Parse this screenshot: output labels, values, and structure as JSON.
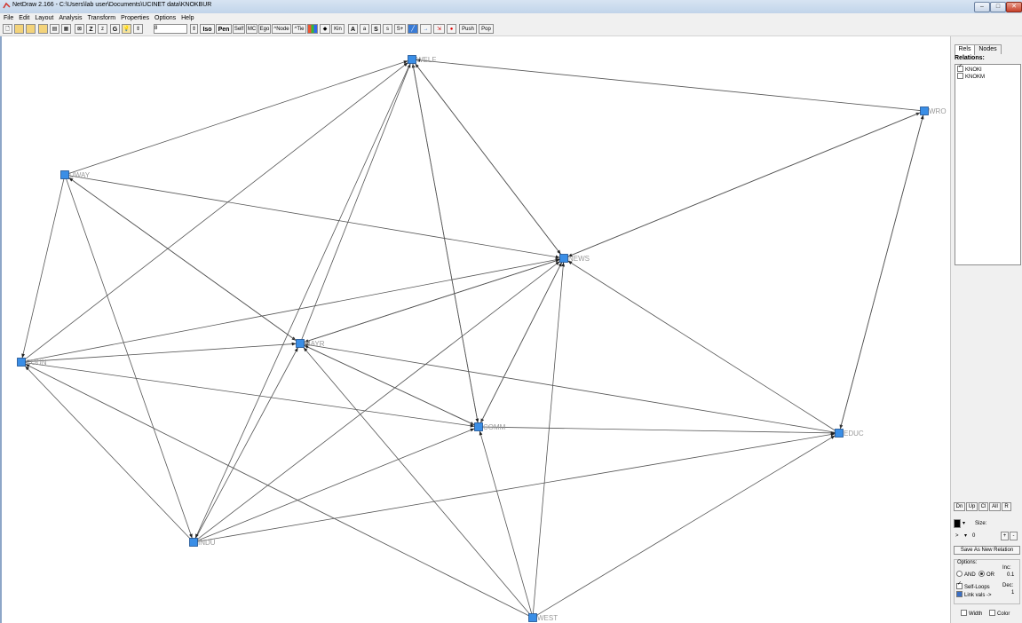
{
  "window": {
    "title": "NetDraw 2.166 - C:\\Users\\lab user\\Documents\\UCINET data\\KNOKBUR",
    "min_label": "–",
    "max_label": "□",
    "close_label": "✕"
  },
  "menu": [
    "File",
    "Edit",
    "Layout",
    "Analysis",
    "Transform",
    "Properties",
    "Options",
    "Help"
  ],
  "toolbar": {
    "z_label": "Z",
    "z_small_label": "z",
    "g_label": "G",
    "iso_label": "Iso",
    "pen_label": "Pen",
    "self_label": "Self",
    "mc_label": "MC",
    "ego_label": "Ego",
    "node_label": "^Node",
    "tie_label": "^Tie",
    "kin_label": "Kin",
    "a_label": "A",
    "a_small_label": "a",
    "s_label": "S",
    "s_small_label": "s",
    "s_plus_label": "S+",
    "push_label": "Push",
    "pop_label": "Pop",
    "spin_value": "8"
  },
  "graph": {
    "node_color": "#3a8ee6",
    "nodes": [
      {
        "id": "WELF",
        "label": "WELF"
      },
      {
        "id": "WRO",
        "label": "WRO"
      },
      {
        "id": "UWAY",
        "label": "UWAY"
      },
      {
        "id": "NEWS",
        "label": "NEWS"
      },
      {
        "id": "MAYR",
        "label": "MAYR"
      },
      {
        "id": "COUN",
        "label": "COUN"
      },
      {
        "id": "COMM",
        "label": "COMM"
      },
      {
        "id": "EDUC",
        "label": "EDUC"
      },
      {
        "id": "INDU",
        "label": "INDU"
      },
      {
        "id": "WEST",
        "label": "WEST"
      }
    ],
    "edges": [
      [
        "UWAY",
        "WELF"
      ],
      [
        "UWAY",
        "NEWS"
      ],
      [
        "UWAY",
        "MAYR"
      ],
      [
        "UWAY",
        "COUN"
      ],
      [
        "UWAY",
        "INDU"
      ],
      [
        "WRO",
        "WELF"
      ],
      [
        "WRO",
        "EDUC"
      ],
      [
        "NEWS",
        "WELF"
      ],
      [
        "NEWS",
        "WRO"
      ],
      [
        "NEWS",
        "MAYR"
      ],
      [
        "NEWS",
        "COMM"
      ],
      [
        "MAYR",
        "WELF"
      ],
      [
        "MAYR",
        "NEWS"
      ],
      [
        "MAYR",
        "UWAY"
      ],
      [
        "MAYR",
        "COMM"
      ],
      [
        "COUN",
        "WELF"
      ],
      [
        "COUN",
        "NEWS"
      ],
      [
        "COUN",
        "MAYR"
      ],
      [
        "COUN",
        "COMM"
      ],
      [
        "COMM",
        "WELF"
      ],
      [
        "COMM",
        "NEWS"
      ],
      [
        "COMM",
        "MAYR"
      ],
      [
        "COMM",
        "EDUC"
      ],
      [
        "EDUC",
        "NEWS"
      ],
      [
        "EDUC",
        "MAYR"
      ],
      [
        "EDUC",
        "WRO"
      ],
      [
        "INDU",
        "MAYR"
      ],
      [
        "INDU",
        "NEWS"
      ],
      [
        "INDU",
        "COMM"
      ],
      [
        "INDU",
        "EDUC"
      ],
      [
        "INDU",
        "COUN"
      ],
      [
        "WEST",
        "NEWS"
      ],
      [
        "WEST",
        "MAYR"
      ],
      [
        "WEST",
        "COMM"
      ],
      [
        "WEST",
        "EDUC"
      ],
      [
        "WEST",
        "COUN"
      ],
      [
        "WELF",
        "COMM"
      ],
      [
        "WELF",
        "INDU"
      ],
      [
        "WELF",
        "NEWS"
      ],
      [
        "WRO",
        "NEWS"
      ]
    ]
  },
  "panel": {
    "tab_rels": "Rels",
    "tab_nodes": "Nodes",
    "relations_title": "Relations:",
    "relations": [
      {
        "label": "KNOKI",
        "checked": true
      },
      {
        "label": "KNOKM",
        "checked": false
      }
    ],
    "btn_dn": "Dn",
    "btn_up": "Up",
    "btn_cl": "Cl",
    "btn_all": "All",
    "btn_r": "R",
    "size_label": "Size:",
    "operator": ">",
    "value": "0",
    "plus": "+",
    "minus": "-",
    "save_label": "Save As New Relation",
    "options_label": "Options:",
    "and_label": "AND",
    "or_label": "OR",
    "inc_label": "Inc:",
    "inc_value": "0.1",
    "dec_label": "Dec:",
    "dec_value": "1",
    "selfloops_label": "Self-Loops",
    "linkvals_label": "Link vals ->",
    "width_label": "Width",
    "color_label": "Color"
  }
}
